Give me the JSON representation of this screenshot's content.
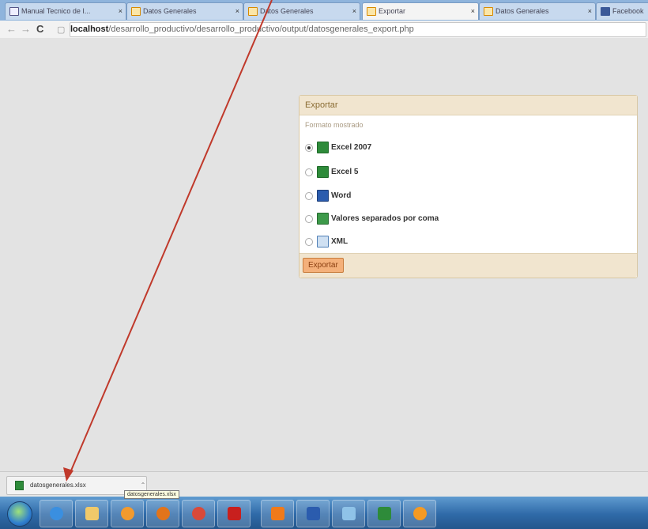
{
  "browser": {
    "tabs": [
      {
        "label": "Manual Tecnico de I...",
        "active": false,
        "icon": "document-icon"
      },
      {
        "label": "Datos Generales",
        "active": false,
        "icon": "page-icon"
      },
      {
        "label": "Datos Generales",
        "active": false,
        "icon": "page-icon"
      },
      {
        "label": "Exportar",
        "active": true,
        "icon": "page-icon"
      },
      {
        "label": "Datos Generales",
        "active": false,
        "icon": "page-icon"
      },
      {
        "label": "Facebook",
        "active": false,
        "icon": "facebook-icon"
      }
    ],
    "tab_close": "×",
    "url_host": "localhost",
    "url_path": "/desarrollo_productivo/desarrollo_productivo/output/datosgenerales_export.php"
  },
  "export_panel": {
    "title": "Exportar",
    "subtitle": "Formato mostrado",
    "options": [
      {
        "label": "Excel 2007",
        "selected": true,
        "icon": "excel-icon"
      },
      {
        "label": "Excel 5",
        "selected": false,
        "icon": "excel-icon"
      },
      {
        "label": "Word",
        "selected": false,
        "icon": "word-icon"
      },
      {
        "label": "Valores separados por coma",
        "selected": false,
        "icon": "csv-icon"
      },
      {
        "label": "XML",
        "selected": false,
        "icon": "xml-icon"
      }
    ],
    "button_label": "Exportar"
  },
  "downloads": {
    "file_name": "datosgenerales.xlsx",
    "tooltip": "datosgenerales.xlsx"
  },
  "taskbar": {
    "items": [
      "ie-icon",
      "explorer-folder-icon",
      "media-player-icon",
      "firefox-icon",
      "chrome-icon",
      "acrobat-icon",
      "app-icon",
      "word-icon",
      "windows-icon",
      "excel-icon",
      "xampp-icon"
    ]
  },
  "colors": {
    "annotation_arrow": "#c0392b",
    "panel_header": "#f1e5cf",
    "export_button": "#f4b07a"
  }
}
